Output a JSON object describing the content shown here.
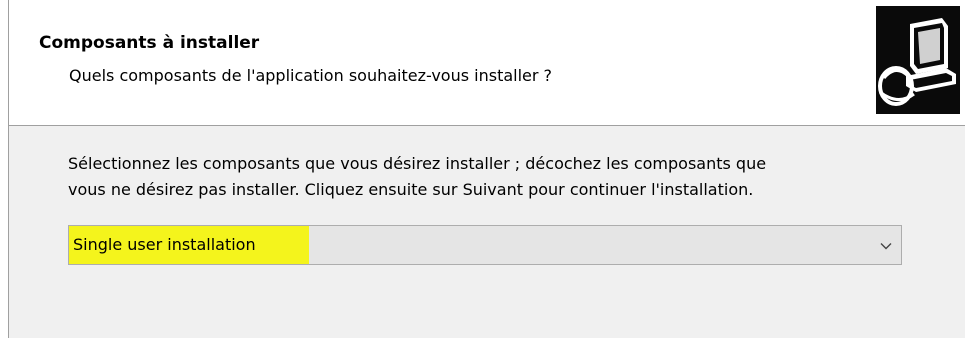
{
  "header": {
    "title": "Composants à installer",
    "subtitle": "Quels composants de l'application souhaitez-vous installer ?",
    "graphic_icon": "computer-setup-icon"
  },
  "content": {
    "description_line1": "Sélectionnez les composants que vous désirez installer ; décochez les composants que",
    "description_line2": "vous ne désirez pas installer. Cliquez ensuite sur Suivant pour continuer l'installation."
  },
  "install_type_select": {
    "selected_value": "Single user installation",
    "highlight_color": "#f4f41c",
    "arrow_icon": "chevron-down-icon"
  }
}
